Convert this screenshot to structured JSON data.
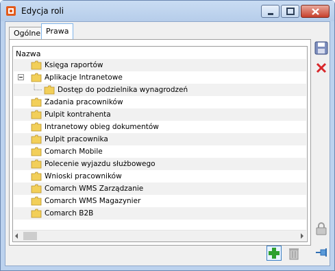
{
  "window": {
    "title": "Edycja roli",
    "accent": "#bcd2ee"
  },
  "tabs": [
    {
      "label": "Ogólne"
    },
    {
      "label": "Prawa",
      "active": true
    }
  ],
  "tree": {
    "column_header": "Nazwa",
    "items": [
      {
        "label": "Księga raportów",
        "level": 0
      },
      {
        "label": "Aplikacje Intranetowe",
        "level": 0,
        "expanded": true
      },
      {
        "label": "Dostęp do podzielnika wynagrodzeń",
        "level": 1
      },
      {
        "label": "Zadania pracowników",
        "level": 0
      },
      {
        "label": "Pulpit kontrahenta",
        "level": 0
      },
      {
        "label": "Intranetowy obieg dokumentów",
        "level": 0
      },
      {
        "label": "Pulpit pracownika",
        "level": 0
      },
      {
        "label": "Comarch Mobile",
        "level": 0
      },
      {
        "label": "Polecenie wyjazdu służbowego",
        "level": 0
      },
      {
        "label": "Wnioski pracowników",
        "level": 0
      },
      {
        "label": "Comarch WMS Zarządzanie",
        "level": 0
      },
      {
        "label": "Comarch WMS Magazynier",
        "level": 0
      },
      {
        "label": "Comarch B2B",
        "level": 0
      }
    ]
  },
  "icons": {
    "save": "floppy-disk-icon",
    "cancel": "red-x-icon",
    "lock": "lock-icon",
    "pin": "pin-icon",
    "add": "green-plus-icon",
    "delete": "trash-icon"
  }
}
